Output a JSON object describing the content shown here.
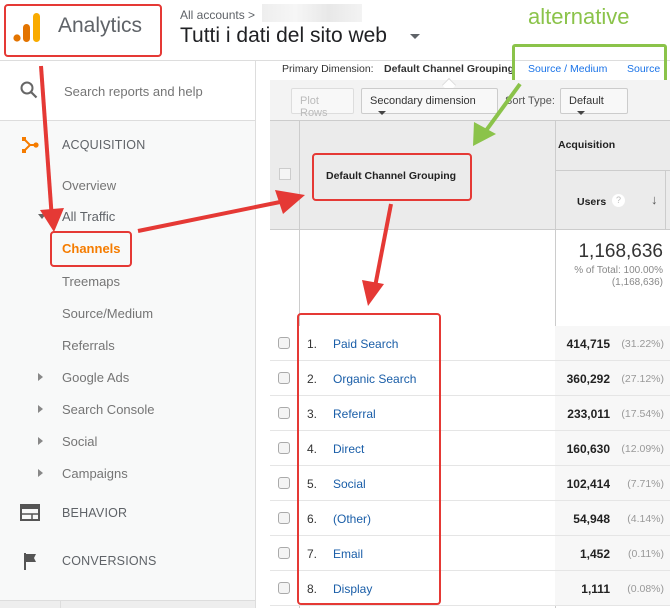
{
  "header": {
    "app_name": "Analytics",
    "breadcrumb": "All accounts >",
    "view_title": "Tutti i dati del sito web",
    "annotation_alternative": "alternative"
  },
  "sidebar": {
    "search_placeholder": "Search reports and help",
    "acquisition": {
      "label": "ACQUISITION",
      "items": [
        {
          "label": "Overview"
        },
        {
          "label": "All Traffic",
          "expanded": true
        }
      ],
      "all_traffic_children": [
        {
          "label": "Channels",
          "active": true
        },
        {
          "label": "Treemaps"
        },
        {
          "label": "Source/Medium"
        },
        {
          "label": "Referrals"
        }
      ],
      "collapsed_groups": [
        {
          "label": "Google Ads"
        },
        {
          "label": "Search Console"
        },
        {
          "label": "Social"
        },
        {
          "label": "Campaigns"
        }
      ]
    },
    "behavior_label": "BEHAVIOR",
    "conversions_label": "CONVERSIONS",
    "accent_color": "#f57c00"
  },
  "primary_dimension": {
    "label": "Primary Dimension:",
    "active": "Default Channel Grouping",
    "alternatives": [
      "Source / Medium",
      "Source"
    ]
  },
  "toolbar": {
    "plot_rows": "Plot Rows",
    "secondary_dimension": "Secondary dimension",
    "sort_type_label": "Sort Type:",
    "sort_type_value": "Default"
  },
  "table": {
    "dimension_header": "Default Channel Grouping",
    "group_header": "Acquisition",
    "metric_header": "Users",
    "help_glyph": "?",
    "sort_glyph": "↓",
    "totals": {
      "value": "1,168,636",
      "pct_line": "% of Total: 100.00%",
      "abs_line": "(1,168,636)"
    },
    "rows": [
      {
        "num": "1.",
        "name": "Paid Search",
        "users": "414,715",
        "pct": "(31.22%)"
      },
      {
        "num": "2.",
        "name": "Organic Search",
        "users": "360,292",
        "pct": "(27.12%)"
      },
      {
        "num": "3.",
        "name": "Referral",
        "users": "233,011",
        "pct": "(17.54%)"
      },
      {
        "num": "4.",
        "name": "Direct",
        "users": "160,630",
        "pct": "(12.09%)"
      },
      {
        "num": "5.",
        "name": "Social",
        "users": "102,414",
        "pct": "(7.71%)"
      },
      {
        "num": "6.",
        "name": "(Other)",
        "users": "54,948",
        "pct": "(4.14%)"
      },
      {
        "num": "7.",
        "name": "Email",
        "users": "1,452",
        "pct": "(0.11%)"
      },
      {
        "num": "8.",
        "name": "Display",
        "users": "1,111",
        "pct": "(0.08%)"
      }
    ]
  },
  "colors": {
    "annotation_red": "#e53935",
    "annotation_green": "#8bc34a",
    "link_blue": "#1a5ea8",
    "brand_orange": "#f57c00"
  }
}
